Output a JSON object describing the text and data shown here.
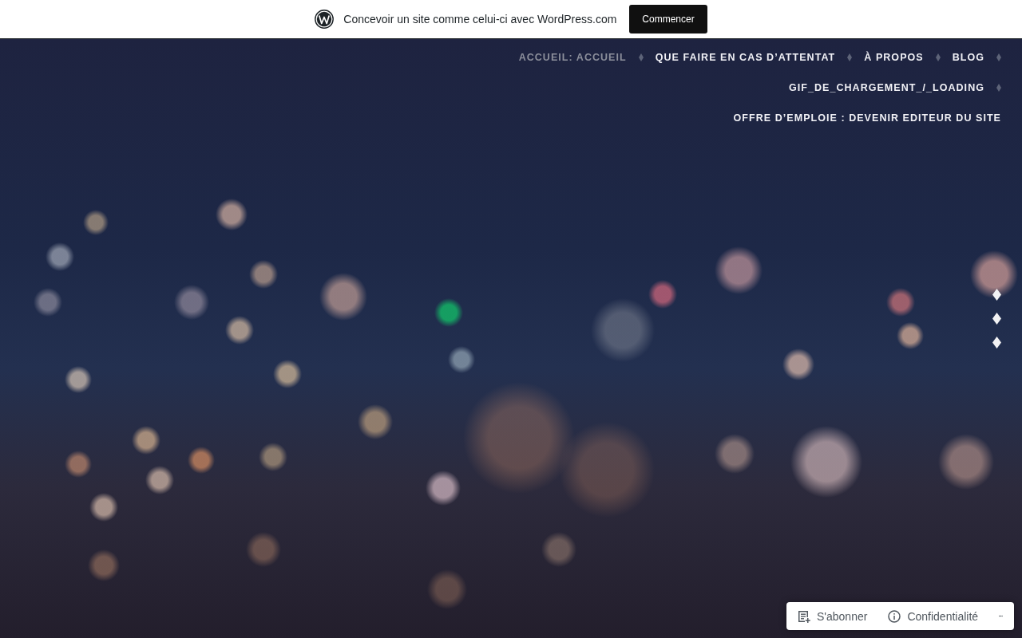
{
  "wpcom_banner": {
    "text": "Concevoir un site comme celui-ci avec WordPress.com",
    "button": "Commencer"
  },
  "nav": {
    "items": [
      {
        "label": "ACCUEIL: ACCUEIL",
        "selected": true
      },
      {
        "label": "QUE FAIRE EN CAS D’ATTENTAT",
        "selected": false
      },
      {
        "label": "À PROPOS",
        "selected": false
      },
      {
        "label": "BLOG",
        "selected": false
      },
      {
        "label": "GIF_DE_CHARGEMENT_/_LOADING",
        "selected": false
      },
      {
        "label": "OFFRE D’EMPLOIE : DEVENIR EDITEUR DU SITE",
        "selected": false
      }
    ]
  },
  "action_bar": {
    "items": [
      {
        "kind": "subscribe",
        "label": "S'abonner"
      },
      {
        "kind": "privacy",
        "label": "Confidentialité"
      }
    ]
  }
}
